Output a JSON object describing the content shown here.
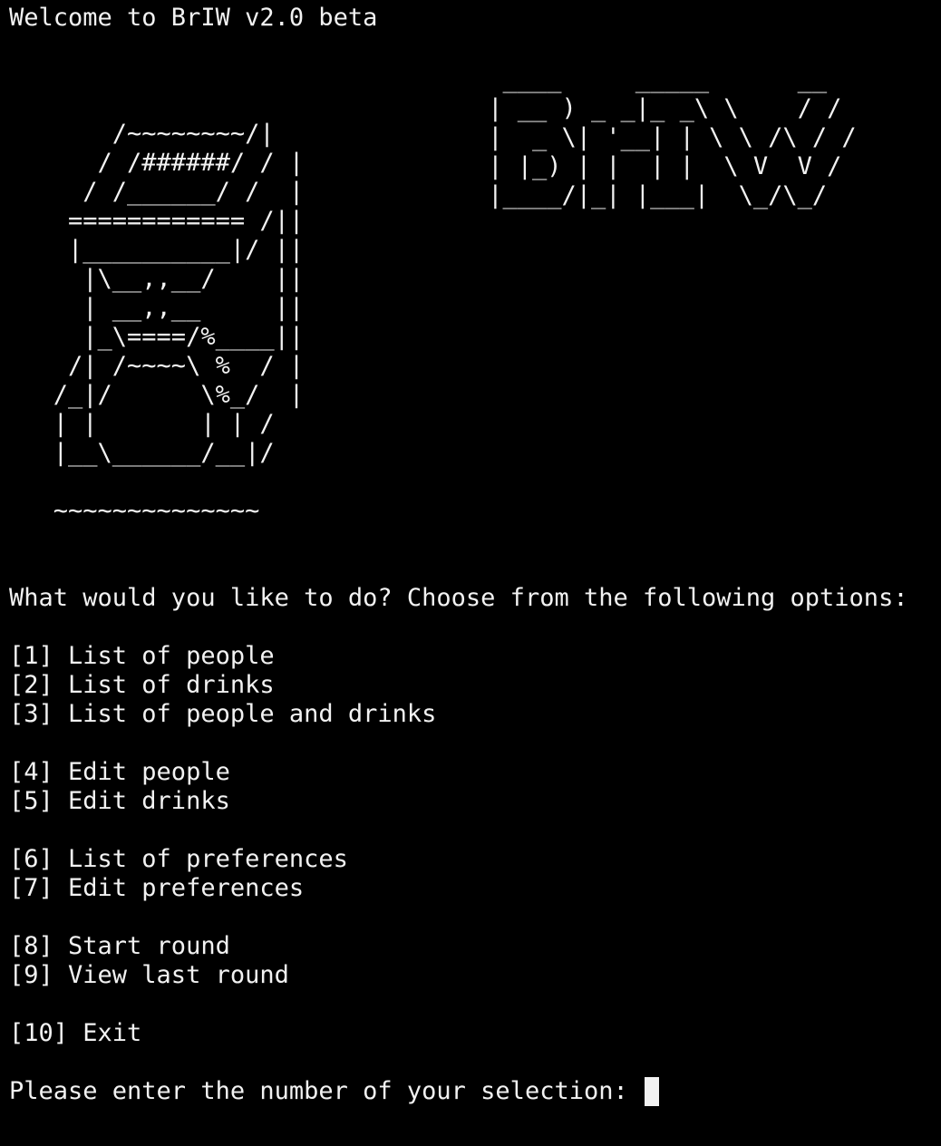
{
  "terminal": {
    "welcome": "Welcome to BrIW v2.0 beta",
    "cup_art": "       /~~~~~~~~/|\n      / /######/ / |\n     / /______/ /  |\n    ============ /||\n    |__________|/ ||\n     |\\__,,__/    ||\n     | __,,__     ||\n     |_\\====/%____||\n    /| /~~~~\\ %  / |\n   /_|/      \\%_/  |\n   | |       | | /\n   |__\\______/__|/\n\n   ~~~~~~~~~~~~~~",
    "banner_art": "  ____     _____      __\n | __ ) _ _|_ _\\ \\    / /\n |  _ \\| '__| | \\ \\ /\\ / /\n | |_) | |  | |  \\ V  V /\n |____/|_| |___|  \\_/\\_/",
    "question": "What would you like to do? Choose from the following options:",
    "options": [
      "[1] List of people",
      "[2] List of drinks",
      "[3] List of people and drinks",
      "[4] Edit people",
      "[5] Edit drinks",
      "[6] List of preferences",
      "[7] Edit preferences",
      "[8] Start round",
      "[9] View last round",
      "[10] Exit"
    ],
    "prompt": "Please enter the number of your selection: ",
    "colors": {
      "background": "#000000",
      "foreground": "#f2f2f2"
    }
  }
}
